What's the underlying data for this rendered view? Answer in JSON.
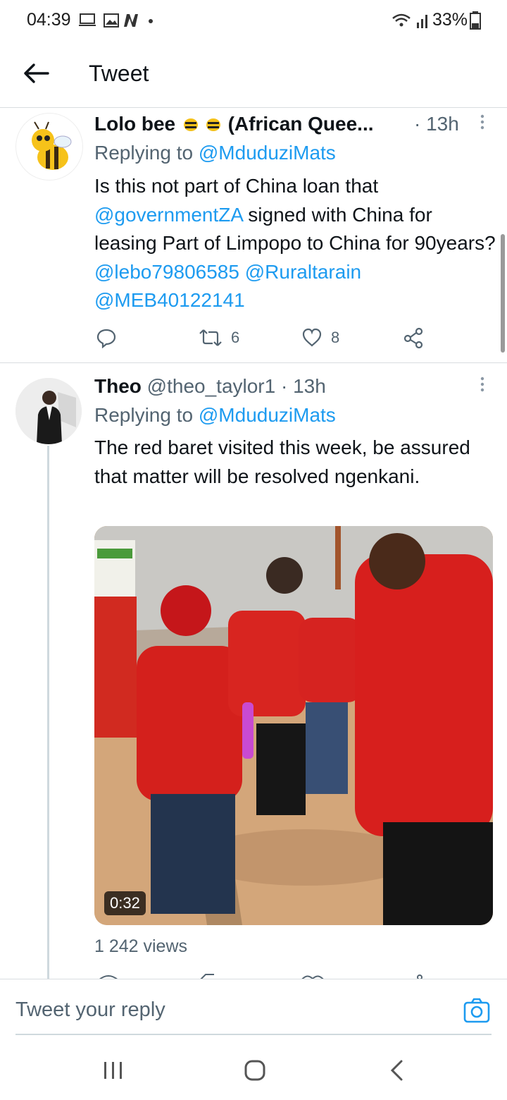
{
  "status_bar": {
    "time": "04:39",
    "battery": "33%"
  },
  "header": {
    "title": "Tweet"
  },
  "tweets": [
    {
      "name": "Lolo bee",
      "name_suffix": "(African Quee...",
      "time": "· 13h",
      "replying_prefix": "Replying to ",
      "replying_handle": "@MduduziMats",
      "text_parts": [
        "Is this not part of China loan that ",
        "@governmentZA",
        " signed with China for leasing Part of Limpopo to China for 90years? ",
        "@lebo79806585",
        " ",
        "@Ruraltarain",
        " ",
        "@MEB40122141"
      ],
      "retweets": "6",
      "likes": "8"
    },
    {
      "name": "Theo",
      "handle": "@theo_taylor1",
      "time": "· 13h",
      "replying_prefix": "Replying to ",
      "replying_handle": "@MduduziMats",
      "text": "The red baret visited this week, be assured that matter will be resolved ngenkani.",
      "video_duration": "0:32",
      "views": "1 242 views"
    }
  ],
  "reply_bar": {
    "placeholder": "Tweet your reply"
  },
  "colors": {
    "link": "#1d9bf0",
    "muted": "#536471",
    "divider": "#d9dde0"
  },
  "icons": [
    "back-arrow-icon",
    "reply-icon",
    "retweet-icon",
    "like-icon",
    "share-icon",
    "more-icon",
    "camera-icon"
  ]
}
